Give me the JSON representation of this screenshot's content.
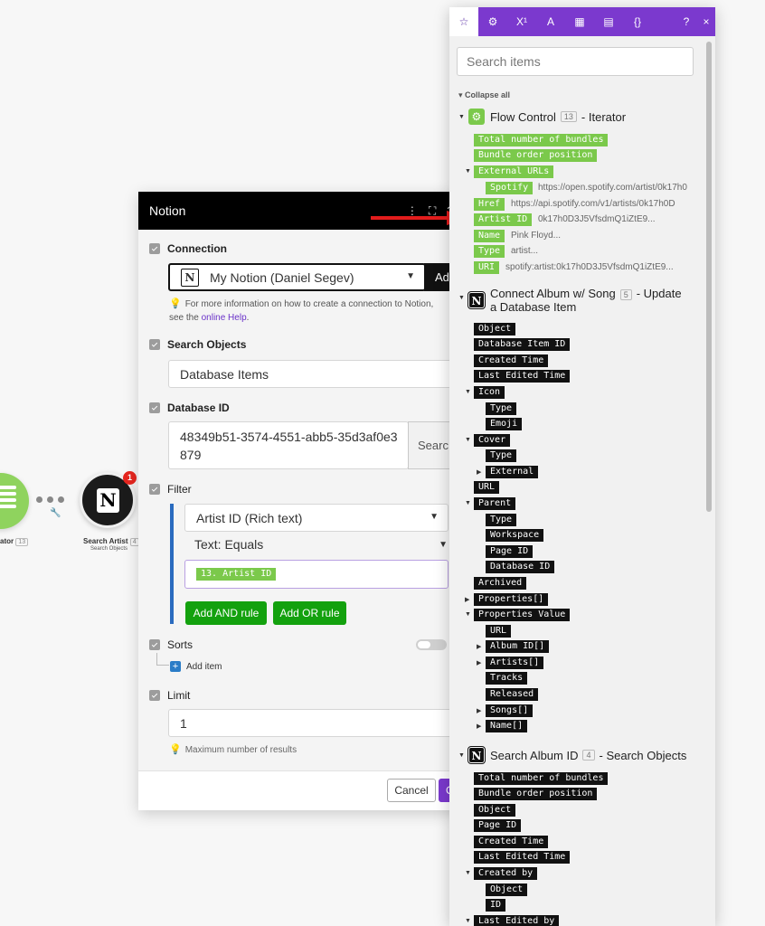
{
  "canvas": {
    "iterator_label": "ator",
    "iterator_badge": "13",
    "notion_alert": "1",
    "notion_label": "Search Artist",
    "notion_badge": "4",
    "notion_sublabel": "Search Objects"
  },
  "dialog": {
    "title": "Notion",
    "connection": {
      "label": "Connection",
      "value": "My Notion (Daniel Segev)",
      "add_button": "Ad",
      "hint_text": "For more information on how to create a connection to Notion, see the",
      "hint_link": "online Help",
      "hint_end": "."
    },
    "search_objects": {
      "label": "Search Objects",
      "value": "Database Items"
    },
    "database_id": {
      "label": "Database ID",
      "value": "48349b51-3574-4551-abb5-35d3af0e3879",
      "search_button": "Searc"
    },
    "filter": {
      "label": "Filter",
      "field": "Artist ID (Rich text)",
      "operator": "Text: Equals",
      "value_pill": "13. Artist ID",
      "and_button": "Add AND rule",
      "or_button": "Add OR rule"
    },
    "sorts": {
      "label": "Sorts",
      "add_item": "Add item"
    },
    "limit": {
      "label": "Limit",
      "value": "1",
      "hint": "Maximum number of results"
    },
    "footer": {
      "cancel": "Cancel",
      "ok": "O"
    }
  },
  "panel": {
    "tabs": [
      "☆",
      "⚙",
      "X¹",
      "A",
      "▦",
      "▤",
      "{}"
    ],
    "help": "?",
    "close": "×",
    "search_placeholder": "Search items",
    "collapse_all": "Collapse all",
    "groups": [
      {
        "name": "Flow Control",
        "num": "13",
        "module": "- Iterator"
      },
      {
        "name": "Connect Album w/ Song",
        "num": "5",
        "module": "- Update",
        "module2": "a Database Item"
      },
      {
        "name": "Search Album ID",
        "num": "4",
        "module": "- Search Objects"
      }
    ],
    "g1": {
      "items": [
        "Total number of bundles",
        "Bundle order position",
        "External URLs",
        "Spotify",
        "Href",
        "Artist ID",
        "Name",
        "Type",
        "URI"
      ],
      "values": {
        "spotify": "https://open.spotify.com/artist/0k17h0",
        "href": "https://api.spotify.com/v1/artists/0k17h0D",
        "artist_id": "0k17h0D3J5VfsdmQ1iZtE9...",
        "name": "Pink Floyd...",
        "type": "artist...",
        "uri": "spotify:artist:0k17h0D3J5VfsdmQ1iZtE9..."
      }
    },
    "g2": {
      "items": [
        "Object",
        "Database Item ID",
        "Created Time",
        "Last Edited Time",
        "Icon",
        "Type",
        "Emoji",
        "Cover",
        "Type",
        "External",
        "URL",
        "Parent",
        "Type",
        "Workspace",
        "Page ID",
        "Database ID",
        "Archived",
        "Properties[]",
        "Properties Value",
        "URL",
        "Album ID[]",
        "Artists[]",
        "Tracks",
        "Released",
        "Songs[]",
        "Name[]"
      ]
    },
    "g3": {
      "items": [
        "Total number of bundles",
        "Bundle order position",
        "Object",
        "Page ID",
        "Created Time",
        "Last Edited Time",
        "Created by",
        "Object",
        "ID",
        "Last Edited by"
      ]
    }
  }
}
